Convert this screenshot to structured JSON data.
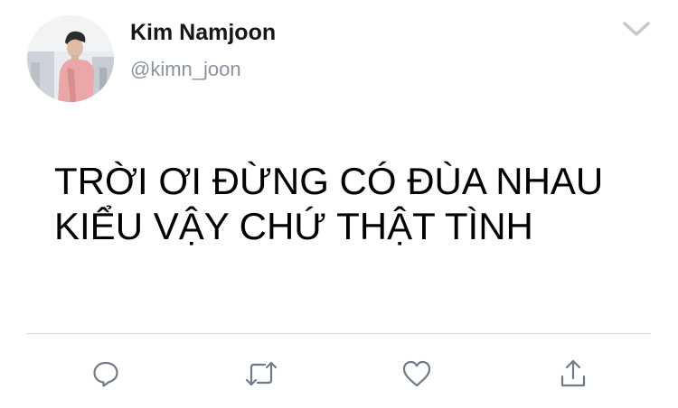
{
  "tweet": {
    "author": {
      "display_name": "Kim Namjoon",
      "handle": "@kimn_joon",
      "avatar_icon": "profile-photo"
    },
    "menu_icon": "chevron-down-icon",
    "text": "TRỜI ƠI ĐỪNG CÓ ĐÙA NHAU\nKIỂU VẬY CHỨ THẬT TÌNH",
    "actions": [
      {
        "name": "reply",
        "icon": "comment-icon"
      },
      {
        "name": "retweet",
        "icon": "retweet-icon"
      },
      {
        "name": "like",
        "icon": "heart-icon"
      },
      {
        "name": "share",
        "icon": "share-icon"
      }
    ]
  },
  "colors": {
    "text_primary": "#14171a",
    "text_secondary": "#8a949e",
    "icon_gray": "#6e7b87",
    "divider": "#cfd6dc"
  }
}
